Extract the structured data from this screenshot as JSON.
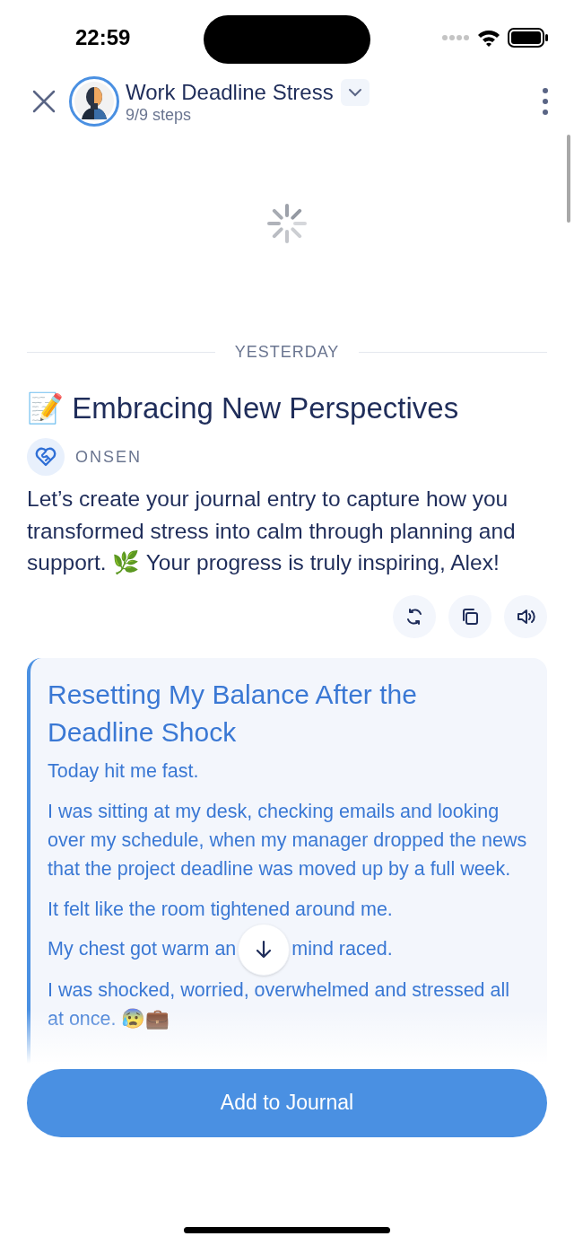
{
  "status_bar": {
    "time": "22:59"
  },
  "header": {
    "title": "Work Deadline Stress",
    "subtitle": "9/9 steps"
  },
  "loading": true,
  "divider_label": "YESTERDAY",
  "message": {
    "title": "📝 Embracing New Perspectives",
    "sender": "ONSEN",
    "text": "Let’s create your journal entry to capture how you transformed stress into calm through planning and support. 🌿 Your progress is truly inspiring, Alex!"
  },
  "actions": [
    {
      "kind": "regenerate"
    },
    {
      "kind": "copy"
    },
    {
      "kind": "speak"
    }
  ],
  "journal": {
    "title": "Resetting My Balance After the Deadline Shock",
    "paragraphs": [
      {
        "text": "Today hit me fast."
      },
      {
        "text": "I was sitting at my desk, checking emails and looking over my schedule, when my manager dropped the news that the project deadline was moved up by a full week."
      },
      {
        "text": "It felt like the room tightened around me."
      },
      {
        "text": "My chest got warm an",
        "after_button": "mind raced."
      },
      {
        "text": "I was shocked, worried, overwhelmed and stressed all at once. 😰💼"
      }
    ]
  },
  "primary_button": "Add to Journal"
}
